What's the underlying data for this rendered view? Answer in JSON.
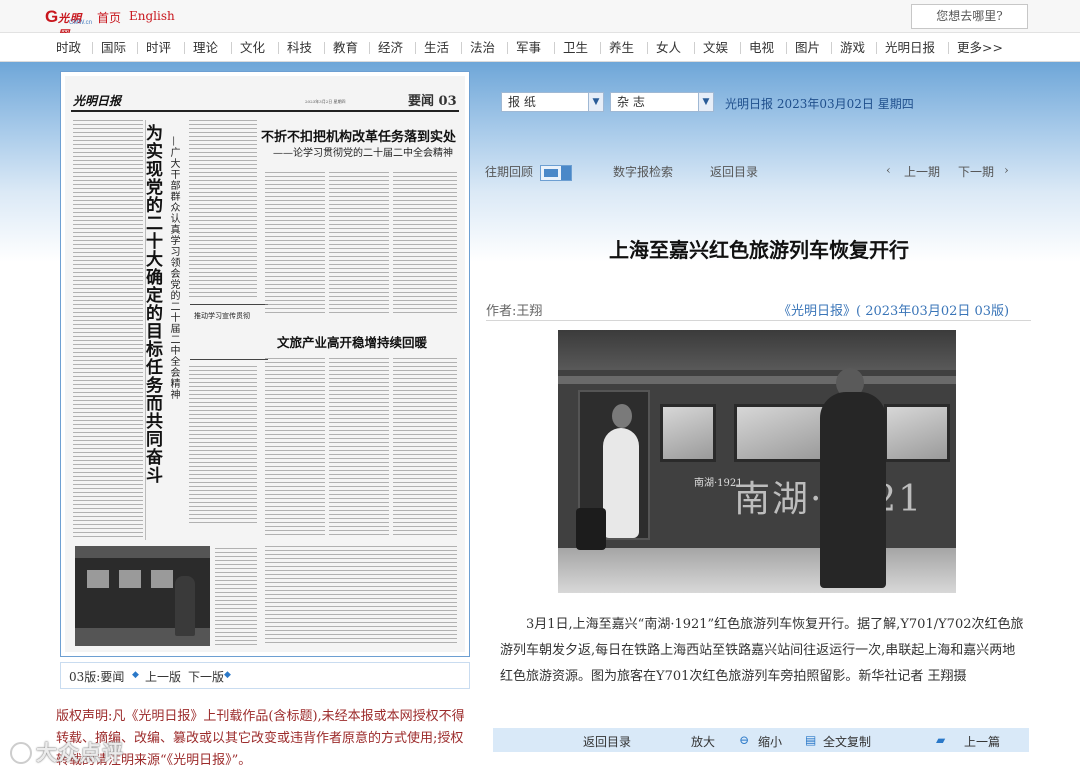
{
  "header": {
    "home": "首页",
    "english": "English",
    "search_placeholder": "您想去哪里?"
  },
  "nav": [
    "时政",
    "国际",
    "时评",
    "理论",
    "文化",
    "科技",
    "教育",
    "经济",
    "生活",
    "法治",
    "军事",
    "卫生",
    "养生",
    "女人",
    "文娱",
    "电视",
    "图片",
    "游戏",
    "光明日报",
    "更多>>"
  ],
  "controls": {
    "paper_select": "报 纸",
    "magazine_select": "杂 志",
    "date_text": "光明日报 2023年03月02日 星期四",
    "review": "往期回顾",
    "digital_search": "数字报检索",
    "return_dir": "返回目录",
    "prev_issue": "上一期",
    "next_issue": "下一期"
  },
  "newspaper": {
    "masthead": "光明日报",
    "section": "要闻 03",
    "date_line": "2023年3月2日 星期四",
    "vertical_headline": "为实现党的二十大确定的目标任务而共同奋斗",
    "vertical_sub": "—广大干部群众认真学习领会党的二十届二中全会精神",
    "headline1": "不折不扣把机构改革任务落到实处",
    "headline1_sub": "——论学习贯彻党的二十届二中全会精神",
    "headline2": "文旅产业高开稳增持续回暖",
    "box_text": "推动学习宣传贯彻",
    "footer_label": "03版:要闻",
    "footer_prev": "上一版",
    "footer_next": "下一版"
  },
  "copyright": "版权声明:凡《光明日报》上刊载作品(含标题),未经本报或本网授权不得转载、摘编、改编、篡改或以其它改变或违背作者原意的方式使用;授权转载的请注明来源“《光明日报》”。",
  "article": {
    "title": "上海至嘉兴红色旅游列车恢复开行",
    "author": "作者:王翔",
    "source": "《光明日报》( 2023年03月02日 03版)",
    "photo_train_text": "南湖·1921",
    "photo_small_text": "南湖·1921",
    "body": "3月1日,上海至嘉兴“南湖·1921”红色旅游列车恢复开行。据了解,Y701/Y702次红色旅游列车朝发夕返,每日在铁路上海西站至铁路嘉兴站间往返运行一次,串联起上海和嘉兴两地红色旅游资源。图为旅客在Y701次红色旅游列车旁拍照留影。新华社记者 王翔摄"
  },
  "bottom_bar": {
    "return_dir": "返回目录",
    "zoom_in": "放大",
    "zoom_out": "缩小",
    "copy_all": "全文复制",
    "prev_article": "上一篇"
  },
  "watermark": "大众点评"
}
